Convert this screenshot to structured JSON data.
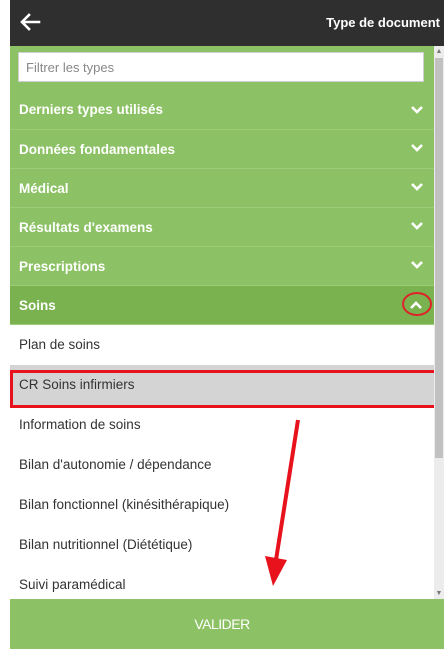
{
  "header": {
    "title": "Type de document",
    "back_icon": "arrow-left-icon"
  },
  "filter": {
    "placeholder": "Filtrer les types",
    "value": ""
  },
  "categories": [
    {
      "label": "Derniers types utilisés",
      "state": "collapsed"
    },
    {
      "label": "Données fondamentales",
      "state": "collapsed"
    },
    {
      "label": "Médical",
      "state": "collapsed"
    },
    {
      "label": "Résultats d'examens",
      "state": "collapsed"
    },
    {
      "label": "Prescriptions",
      "state": "collapsed"
    },
    {
      "label": "Soins",
      "state": "expanded"
    }
  ],
  "soins_items": [
    {
      "label": "Plan de soins"
    },
    {
      "label": "CR Soins infirmiers",
      "selected": true
    },
    {
      "label": "Information de soins"
    },
    {
      "label": "Bilan d'autonomie / dépendance"
    },
    {
      "label": "Bilan fonctionnel (kinésithérapique)"
    },
    {
      "label": "Bilan nutritionnel (Diététique)"
    },
    {
      "label": "Suivi paramédical"
    }
  ],
  "footer": {
    "validate_label": "VALIDER"
  },
  "colors": {
    "header_bg": "#2f2f2f",
    "green": "#8cc265",
    "selected_row": "#d4d4d4",
    "annotation_red": "#e8121c"
  }
}
